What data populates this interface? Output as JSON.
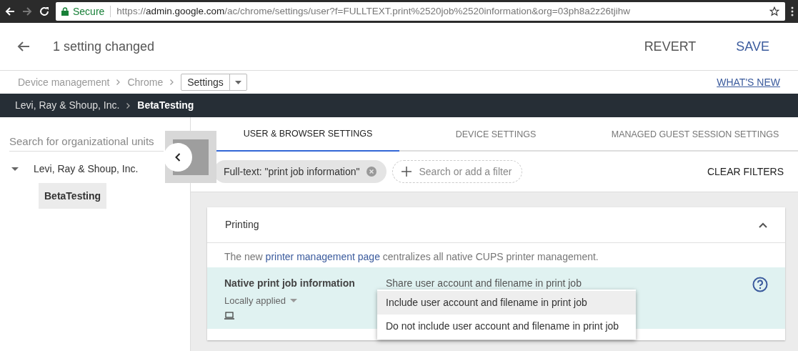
{
  "browser": {
    "secure": "Secure",
    "url_scheme": "https://",
    "url_host": "admin.google.com",
    "url_path": "/ac/chrome/settings/user?f=FULLTEXT.print%2520job%2520information&org=03ph8a2z26tjihw"
  },
  "header": {
    "title": "1 setting changed",
    "buttons": [
      {
        "label": "REVERT",
        "kind": "revert"
      },
      {
        "label": "SAVE",
        "kind": "save"
      }
    ]
  },
  "breadcrumb": {
    "items": [
      "Device management",
      "Chrome"
    ],
    "current": "Settings",
    "link": "WHAT'S NEW"
  },
  "org_bar": {
    "items": [
      "Levi, Ray & Shoup, Inc.",
      "BetaTesting"
    ]
  },
  "sidebar": {
    "search_placeholder": "Search for organizational units",
    "tree": [
      {
        "label": "Levi, Ray & Shoup, Inc.",
        "expanded": true,
        "selected": false,
        "children": [
          {
            "label": "BetaTesting",
            "selected": true
          }
        ]
      }
    ]
  },
  "tabs": [
    {
      "label": "USER & BROWSER SETTINGS",
      "selected": true
    },
    {
      "label": "DEVICE SETTINGS",
      "selected": false
    },
    {
      "label": "MANAGED GUEST SESSION SETTINGS",
      "selected": false
    }
  ],
  "filters": {
    "chips": [
      "Full-text: \"print job information\""
    ],
    "add_placeholder": "Search or add a filter",
    "clear": "CLEAR FILTERS"
  },
  "section": {
    "title": "Printing",
    "expanded": true,
    "intro_before": "The new ",
    "intro_link": "printer management page",
    "intro_after": " centralizes all native CUPS printer management.",
    "setting": {
      "name": "Native print job information",
      "status": "Locally applied",
      "value": "Share user account and filename in print job",
      "options": [
        {
          "label": "Include user account and filename in print job",
          "selected": true
        },
        {
          "label": "Do not include user account and filename in print job",
          "selected": false
        }
      ]
    }
  }
}
